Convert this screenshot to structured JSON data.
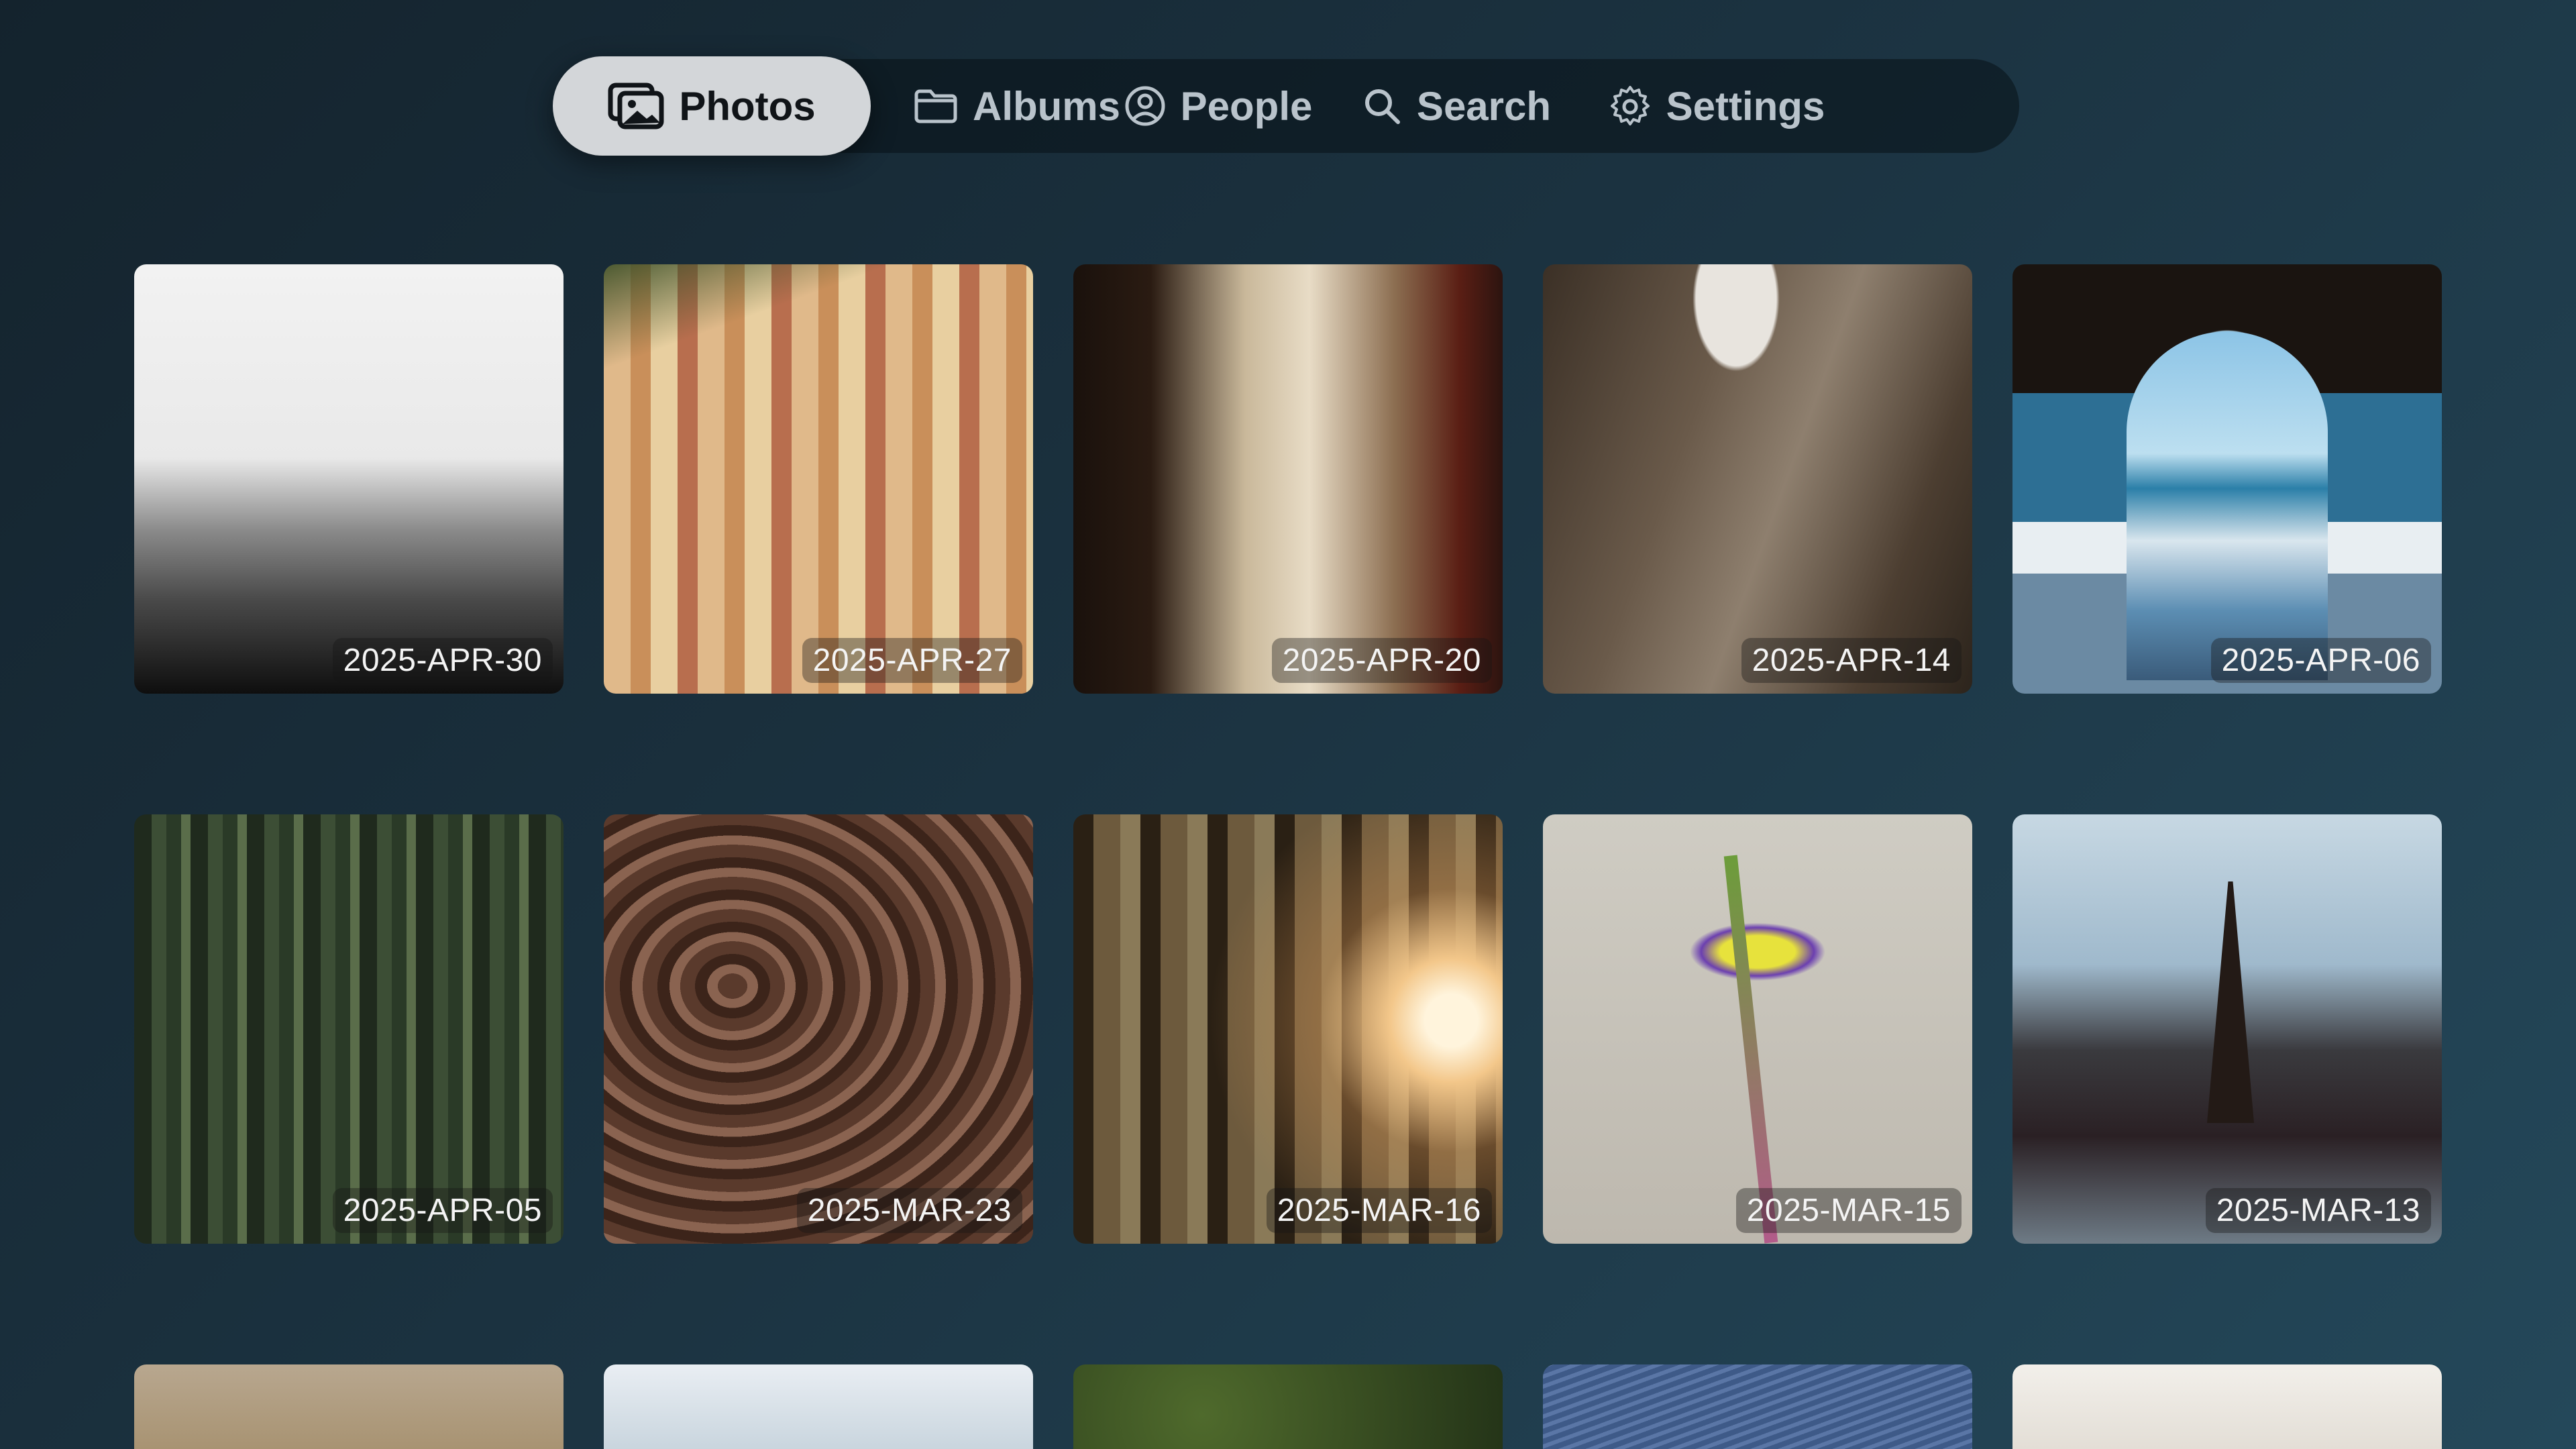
{
  "nav": {
    "items": [
      {
        "label": "Photos",
        "icon": "photos-icon",
        "active": true
      },
      {
        "label": "Albums",
        "icon": "folder-icon",
        "active": false
      },
      {
        "label": "People",
        "icon": "person-circle-icon",
        "active": false
      },
      {
        "label": "Search",
        "icon": "search-icon",
        "active": false
      },
      {
        "label": "Settings",
        "icon": "gear-icon",
        "active": false
      }
    ]
  },
  "photos": [
    {
      "date": "2025-APR-30"
    },
    {
      "date": "2025-APR-27"
    },
    {
      "date": "2025-APR-20"
    },
    {
      "date": "2025-APR-14"
    },
    {
      "date": "2025-APR-06"
    },
    {
      "date": "2025-APR-05"
    },
    {
      "date": "2025-MAR-23"
    },
    {
      "date": "2025-MAR-16"
    },
    {
      "date": "2025-MAR-15"
    },
    {
      "date": "2025-MAR-13"
    }
  ],
  "colors": {
    "background": "#1b3240",
    "nav_active": "#d3d6d9",
    "nav_text": "#b9c3cb"
  }
}
